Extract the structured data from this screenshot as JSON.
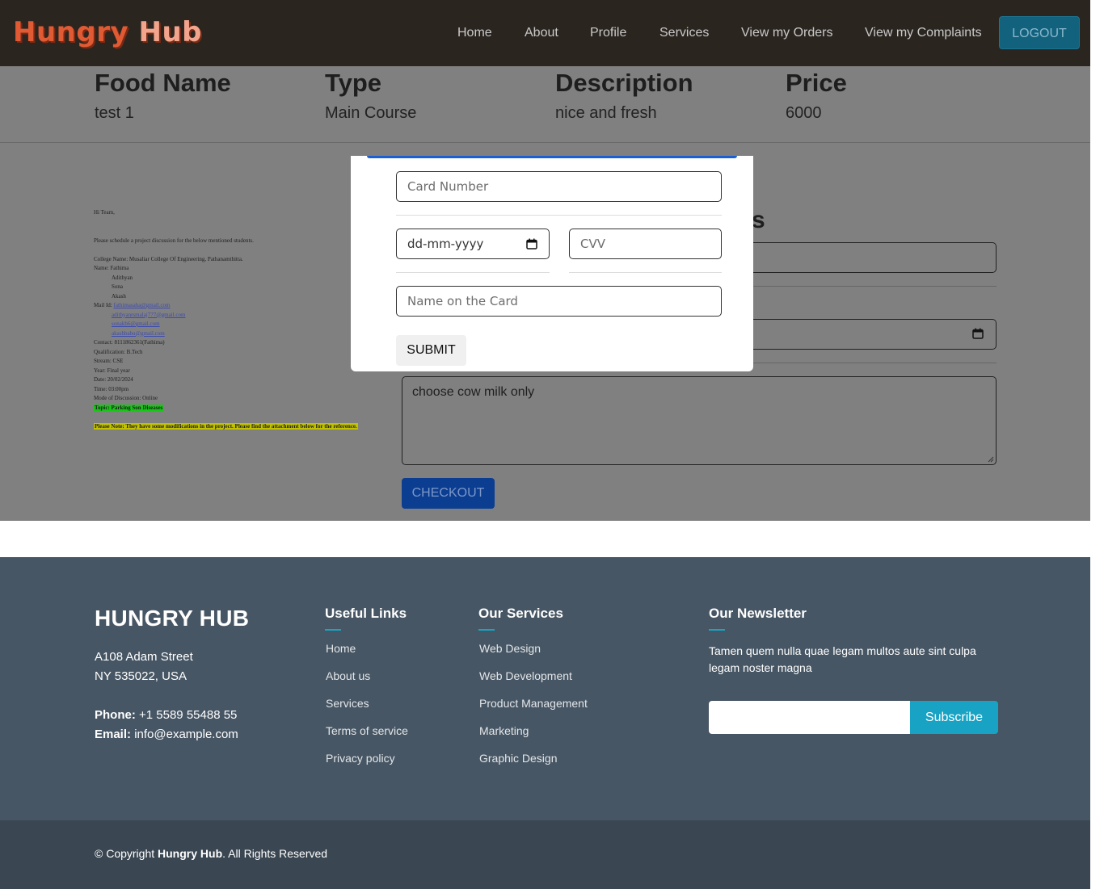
{
  "nav": {
    "logo_part1": "Hungry",
    "logo_part2": "Hub",
    "links": [
      "Home",
      "About",
      "Profile",
      "Services",
      "View my Orders",
      "View my Complaints"
    ],
    "logout_label": "LOGOUT"
  },
  "food": {
    "headers": [
      "Food Name",
      "Type",
      "Description",
      "Price"
    ],
    "values": [
      "test 1",
      "Main Course",
      "nice and fresh",
      "6000"
    ]
  },
  "document": {
    "greeting": "Hi Team,",
    "intro": "Please schedule a project discussion for the below mentioned students.",
    "college": "College Name: Musaliar College Of Engineering, Pathanamthitta.",
    "name_label": "Name: Fathima",
    "names": [
      "Adithyan",
      "Sona",
      "Akash"
    ],
    "mail_label": "Mail Id:",
    "mails": [
      "fathimasaha@gmail.com",
      "adithyanrsmalaj777@gmail.com",
      "sonakb6@gmail.com",
      "akashbabu@gmail.com"
    ],
    "contact": "Contact: 8111862361(Fathima)",
    "qualification": "Qualification: B.Tech",
    "stream": "Stream: CSE",
    "year": "Year: Final year",
    "date": "Date: 20/02/2024",
    "time": "Time: 03:00pm",
    "mode": "Mode of Discussion: Online",
    "topic": "Topic: Parking Son Diseases",
    "note": "Please Note: They have some modifications in the project. Please find the attachment below for the reference."
  },
  "order": {
    "heading_fragment": "s",
    "notes_value": "choose cow milk only",
    "checkout_label": "CHECKOUT"
  },
  "payment_modal": {
    "card_number_placeholder": "Card Number",
    "date_placeholder": "dd-mm-yyyy",
    "cvv_placeholder": "CVV",
    "name_placeholder": "Name on the Card",
    "submit_label": "SUBMIT"
  },
  "footer": {
    "brand": "HUNGRY HUB",
    "address_line1": "A108 Adam Street",
    "address_line2": "NY 535022, USA",
    "phone_label": "Phone:",
    "phone": "+1 5589 55488 55",
    "email_label": "Email:",
    "email": "info@example.com",
    "useful_links_title": "Useful Links",
    "useful_links": [
      "Home",
      "About us",
      "Services",
      "Terms of service",
      "Privacy policy"
    ],
    "services_title": "Our Services",
    "services": [
      "Web Design",
      "Web Development",
      "Product Management",
      "Marketing",
      "Graphic Design"
    ],
    "newsletter_title": "Our Newsletter",
    "newsletter_text": "Tamen quem nulla quae legam multos aute sint culpa legam noster magna",
    "subscribe_label": "Subscribe",
    "copyright_prefix": "© Copyright",
    "copyright_brand": "Hungry Hub",
    "copyright_suffix": ". All Rights Reserved"
  },
  "colors": {
    "navbar_bg": "#2b2520",
    "overlay_bg": "#808080",
    "accent": "#18a3c4",
    "footer_bg": "#475664",
    "copyright_bg": "#3a4651",
    "modal_topbar": "#1a5fd6"
  }
}
